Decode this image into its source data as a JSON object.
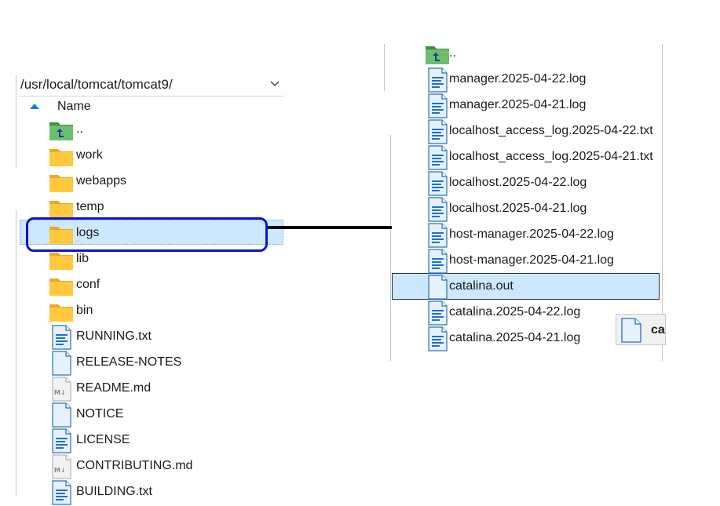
{
  "left_panel": {
    "path": "/usr/local/tomcat/tomcat9/",
    "column_header": "Name",
    "items": [
      {
        "name": "..",
        "type": "parent"
      },
      {
        "name": "work",
        "type": "folder"
      },
      {
        "name": "webapps",
        "type": "folder"
      },
      {
        "name": "temp",
        "type": "folder"
      },
      {
        "name": "logs",
        "type": "folder",
        "selected": true
      },
      {
        "name": "lib",
        "type": "folder"
      },
      {
        "name": "conf",
        "type": "folder"
      },
      {
        "name": "bin",
        "type": "folder"
      },
      {
        "name": "RUNNING.txt",
        "type": "text-file"
      },
      {
        "name": "RELEASE-NOTES",
        "type": "blank-file"
      },
      {
        "name": "README.md",
        "type": "markdown-file"
      },
      {
        "name": "NOTICE",
        "type": "blank-file"
      },
      {
        "name": "LICENSE",
        "type": "text-file"
      },
      {
        "name": "CONTRIBUTING.md",
        "type": "markdown-file"
      },
      {
        "name": "BUILDING.txt",
        "type": "text-file"
      }
    ]
  },
  "right_panel": {
    "items": [
      {
        "name": "..",
        "type": "parent"
      },
      {
        "name": "manager.2025-04-22.log",
        "type": "text-file"
      },
      {
        "name": "manager.2025-04-21.log",
        "type": "text-file"
      },
      {
        "name": "localhost_access_log.2025-04-22.txt",
        "type": "text-file"
      },
      {
        "name": "localhost_access_log.2025-04-21.txt",
        "type": "text-file"
      },
      {
        "name": "localhost.2025-04-22.log",
        "type": "text-file"
      },
      {
        "name": "localhost.2025-04-21.log",
        "type": "text-file"
      },
      {
        "name": "host-manager.2025-04-22.log",
        "type": "text-file"
      },
      {
        "name": "host-manager.2025-04-21.log",
        "type": "text-file"
      },
      {
        "name": "catalina.out",
        "type": "blank-file",
        "selected": true
      },
      {
        "name": "catalina.2025-04-22.log",
        "type": "text-file"
      },
      {
        "name": "catalina.2025-04-21.log",
        "type": "text-file"
      }
    ]
  },
  "drag_tooltip": {
    "label": "ca"
  },
  "colors": {
    "selection": "#cce8ff",
    "highlight_ring": "#1010d8",
    "folder": "#ffc83d",
    "file_lines": "#1e6fd9",
    "parent_folder": "#5fb35f"
  }
}
